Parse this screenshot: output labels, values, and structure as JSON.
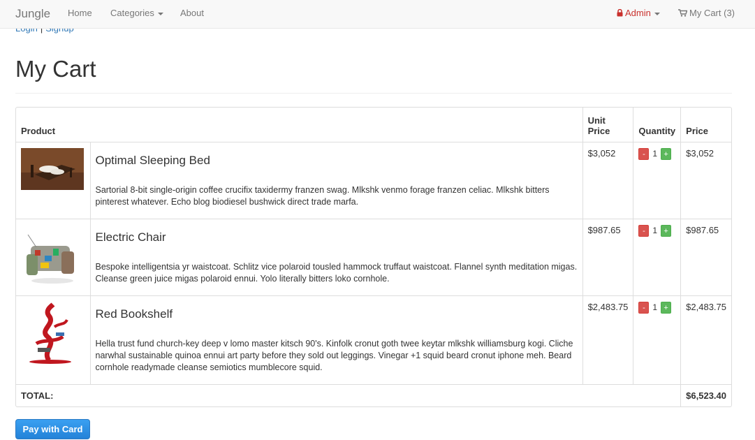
{
  "navbar": {
    "brand": "Jungle",
    "links": {
      "home": "Home",
      "categories": "Categories",
      "about": "About"
    },
    "admin": "Admin",
    "cart": "My Cart (3)"
  },
  "auth": {
    "login": "Login",
    "separator": "|",
    "signup": "Signup"
  },
  "page": {
    "title": "My Cart"
  },
  "table": {
    "headers": {
      "product": "Product",
      "unit_price": "Unit Price",
      "quantity": "Quantity",
      "price": "Price"
    },
    "items": [
      {
        "name": "Optimal Sleeping Bed",
        "description": "Sartorial 8-bit single-origin coffee crucifix taxidermy franzen swag. Mlkshk venmo forage franzen celiac. Mlkshk bitters pinterest whatever. Echo blog biodiesel bushwick direct trade marfa.",
        "unit_price": "$3,052",
        "quantity": "1",
        "price": "$3,052",
        "minus": "-",
        "plus": "+"
      },
      {
        "name": "Electric Chair",
        "description": "Bespoke intelligentsia yr waistcoat. Schlitz vice polaroid tousled hammock truffaut waistcoat. Flannel synth meditation migas. Cleanse green juice migas polaroid ennui. Yolo literally bitters loko cornhole.",
        "unit_price": "$987.65",
        "quantity": "1",
        "price": "$987.65",
        "minus": "-",
        "plus": "+"
      },
      {
        "name": "Red Bookshelf",
        "description": "Hella trust fund church-key deep v lomo master kitsch 90's. Kinfolk cronut goth twee keytar mlkshk williamsburg kogi. Cliche narwhal sustainable quinoa ennui art party before they sold out leggings. Vinegar +1 squid beard cronut iphone meh. Beard cornhole readymade cleanse semiotics mumblecore squid.",
        "unit_price": "$2,483.75",
        "quantity": "1",
        "price": "$2,483.75",
        "minus": "-",
        "plus": "+"
      }
    ],
    "total_label": "TOTAL:",
    "total_value": "$6,523.40"
  },
  "pay_button": "Pay with Card",
  "colors": {
    "link": "#337ab7",
    "admin": "#c9302c",
    "minus_button": "#d9534f",
    "plus_button": "#5cb85c",
    "pay_button": "#2382d8"
  },
  "icons": [
    "lock-icon",
    "cart-icon",
    "chevron-down-icon"
  ]
}
